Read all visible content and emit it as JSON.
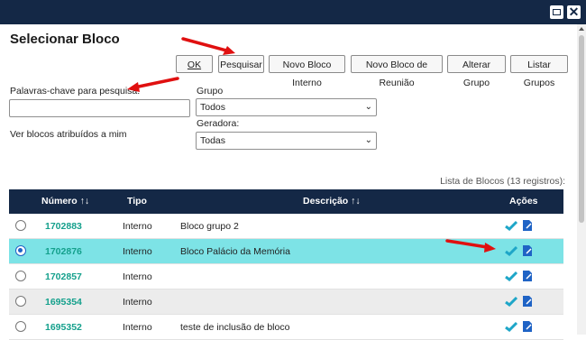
{
  "window": {
    "buttons": [
      {
        "name": "maximize-icon"
      },
      {
        "name": "close-icon",
        "glyph": "✕"
      }
    ]
  },
  "page": {
    "title": "Selecionar Bloco"
  },
  "toolbar": {
    "ok_label": "OK",
    "pesquisar_label": "Pesquisar",
    "novo_bloco_interno_label": "Novo Bloco Interno",
    "novo_bloco_reuniao_label": "Novo Bloco de Reunião",
    "alterar_grupo_label": "Alterar Grupo",
    "listar_grupos_label": "Listar Grupos"
  },
  "filters": {
    "keywords_label": "Palavras-chave para pesquisa:",
    "keywords_value": "",
    "assigned_label": "Ver blocos atribuídos a mim",
    "grupo_label": "Grupo",
    "grupo_value": "Todos",
    "geradora_label": "Geradora:",
    "geradora_value": "Todas"
  },
  "table": {
    "caption": "Lista de Blocos (13 registros):",
    "headers": {
      "numero": "Número",
      "tipo": "Tipo",
      "descricao": "Descrição",
      "acoes": "Ações",
      "sort_glyph": "↑↓"
    },
    "rows": [
      {
        "numero": "1702883",
        "tipo": "Interno",
        "descricao": "Bloco grupo 2",
        "selected": false
      },
      {
        "numero": "1702876",
        "tipo": "Interno",
        "descricao": "Bloco Palácio da Memória",
        "selected": true
      },
      {
        "numero": "1702857",
        "tipo": "Interno",
        "descricao": "",
        "selected": false
      },
      {
        "numero": "1695354",
        "tipo": "Interno",
        "descricao": "",
        "selected": false
      },
      {
        "numero": "1695352",
        "tipo": "Interno",
        "descricao": "teste de inclusão de bloco",
        "selected": false
      }
    ]
  },
  "colors": {
    "header_bg": "#142846",
    "selected_row": "#7de3e6",
    "number_text": "#14a08c",
    "annotation_arrow": "#e01010"
  }
}
